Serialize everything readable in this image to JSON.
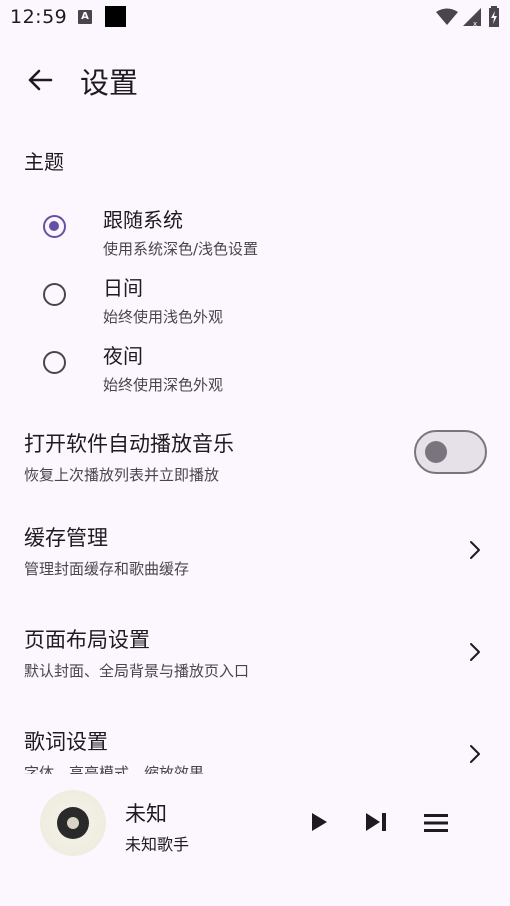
{
  "status": {
    "time": "12:59",
    "a_icon": "A"
  },
  "header": {
    "title": "设置"
  },
  "theme": {
    "section_title": "主题",
    "options": [
      {
        "label": "跟随系统",
        "desc": "使用系统深色/浅色设置",
        "selected": true
      },
      {
        "label": "日间",
        "desc": "始终使用浅色外观",
        "selected": false
      },
      {
        "label": "夜间",
        "desc": "始终使用深色外观",
        "selected": false
      }
    ]
  },
  "settings": {
    "autoplay": {
      "title": "打开软件自动播放音乐",
      "desc": "恢复上次播放列表并立即播放",
      "enabled": false
    },
    "cache": {
      "title": "缓存管理",
      "desc": "管理封面缓存和歌曲缓存"
    },
    "layout": {
      "title": "页面布局设置",
      "desc": "默认封面、全局背景与播放页入口"
    },
    "lyrics": {
      "title": "歌词设置",
      "desc": "字体、高亮模式、缩放效果"
    }
  },
  "player": {
    "title": "未知",
    "artist": "未知歌手"
  },
  "colors": {
    "background": "#fcf7fe",
    "accent": "#6750a4",
    "text_primary": "#1d1b20",
    "text_secondary": "#49454f"
  },
  "icons": {
    "back": "arrow-back-icon",
    "chevron": "chevron-right-icon",
    "play": "play-icon",
    "next": "skip-next-icon",
    "queue": "queue-menu-icon"
  }
}
